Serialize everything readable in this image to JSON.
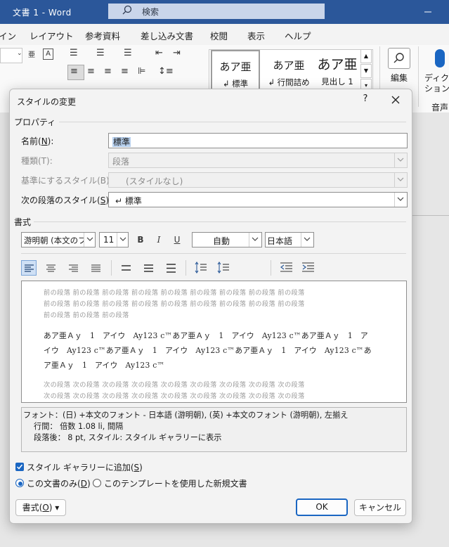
{
  "app": {
    "title": "文書 1  -  Word",
    "search_placeholder": "検索"
  },
  "menu": [
    "イン",
    "レイアウト",
    "参考資料",
    "差し込み文書",
    "校閲",
    "表示",
    "ヘルプ"
  ],
  "ribbon": {
    "styles": [
      {
        "preview": "あア亜",
        "label": "↲ 標準"
      },
      {
        "preview": "あア亜",
        "label": "↲ 行間詰め"
      },
      {
        "preview": "あア亜",
        "label": "見出し 1"
      }
    ],
    "edit_label": "編集",
    "dictate_label": "ディクテ\nション",
    "voice_group": "音声"
  },
  "dialog": {
    "title": "スタイルの変更",
    "help": "?",
    "properties_section": "プロパティ",
    "name_label": "名前(",
    "name_key": "N",
    "name_value": "標準",
    "type_label": "種類(T):",
    "type_value": "段落",
    "base_label": "基準にするスタイル(B):",
    "base_value": "(スタイルなし)",
    "next_label": "次の段落のスタイル(",
    "next_key": "S",
    "next_value": "↵ 標準",
    "format_section": "書式",
    "font_value": "游明朝 (本文のフ",
    "size_value": "11",
    "bold": "B",
    "italic": "I",
    "underline": "U",
    "color_value": "自動",
    "lang_value": "日本語",
    "preview_prev": [
      "前の段落 前の段落 前の段落 前の段落 前の段落 前の段落 前の段落 前の段落 前の段落",
      "前の段落 前の段落 前の段落 前の段落 前の段落 前の段落 前の段落 前の段落 前の段落",
      "前の段落 前の段落 前の段落"
    ],
    "preview_main": [
      "あア亜Ａｙ　1　アイウ　Ay123 c™あア亜Ａｙ　1　アイウ　Ay123 c™あア亜Ａｙ　1　ア",
      "イウ　Ay123 c™あア亜Ａｙ　1　アイウ　Ay123 c™あア亜Ａｙ　1　アイウ　Ay123 c™あ",
      "ア亜Ａｙ　1　アイウ　Ay123 c™"
    ],
    "preview_next": [
      "次の段落 次の段落 次の段落 次の段落 次の段落 次の段落 次の段落 次の段落 次の段落",
      "次の段落 次の段落 次の段落 次の段落 次の段落 次の段落 次の段落 次の段落 次の段落"
    ],
    "description": [
      "フォント：(日) +本文のフォント - 日本語 (游明朝), (英) +本文のフォント (游明朝), 左揃え",
      "行間：  倍数 1.08 li, 間隔",
      "段落後：  8 pt, スタイル: スタイル ギャラリーに表示"
    ],
    "add_to_gallery": "スタイル ギャラリーに追加(",
    "add_to_gallery_key": "S",
    "only_this_doc": "この文書のみ(",
    "only_this_doc_key": "D",
    "new_docs_template": "このテンプレートを使用した新規文書",
    "format_button": "書式(",
    "format_key": "O",
    "ok": "OK",
    "cancel": "キャンセル"
  },
  "colors": {
    "accent": "#1a66c2",
    "titlebar": "#2b579a"
  }
}
